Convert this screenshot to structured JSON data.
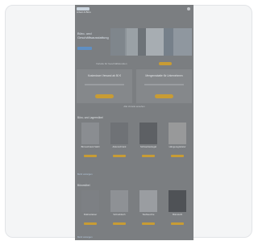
{
  "page": {
    "status_bar": {
      "title": "Arbeit & Büro"
    },
    "hero": {
      "headline": "Büro- und Geschäftsausstattung",
      "cta": "Jetzt shoppen"
    },
    "strip": {
      "text": "Vorteile für Geschäftskunden",
      "pill": "Mehr"
    },
    "offers": [
      {
        "title": "Kostenloser Versand ab 50 €",
        "cta": "Mehr"
      },
      {
        "title": "Mengenrabatte für Unternehmen",
        "cta": "Mehr"
      }
    ],
    "offers_link": "Alle Vorteile ansehen",
    "sections": [
      {
        "title": "Büro- und Lagermöbel",
        "link": "Mehr anzeigen",
        "items": [
          {
            "name": "Büroschrank Stahl",
            "price": ""
          },
          {
            "name": "Aktenschrank",
            "price": ""
          },
          {
            "name": "Schwerlastregal",
            "price": ""
          },
          {
            "name": "Hängeregistratur",
            "price": ""
          }
        ]
      },
      {
        "title": "Büromöbel",
        "link": "Mehr anzeigen",
        "items": [
          {
            "name": "Rollcontainer",
            "price": ""
          },
          {
            "name": "Schreibtisch",
            "price": ""
          },
          {
            "name": "Stehleuchte",
            "price": ""
          },
          {
            "name": "Bürostuhl",
            "price": ""
          }
        ]
      }
    ]
  },
  "colors": {
    "accent": "#c89c34",
    "link": "#5f8fc3",
    "overlay": "#7b7e81"
  },
  "icons": [
    "menu-icon"
  ]
}
